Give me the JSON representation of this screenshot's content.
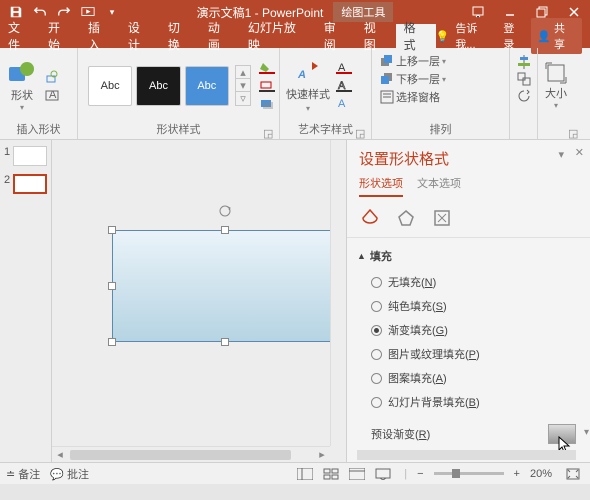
{
  "title": {
    "document": "演示文稿1 - PowerPoint",
    "context_tab": "绘图工具"
  },
  "tabs": {
    "file": "文件",
    "home": "开始",
    "insert": "插入",
    "design": "设计",
    "transitions": "切换",
    "animations": "动画",
    "slideshow": "幻灯片放映",
    "review": "审阅",
    "view": "视图",
    "format": "格式"
  },
  "tab_right": {
    "tell_me": "告诉我...",
    "sign_in": "登录",
    "share": "共享"
  },
  "ribbon": {
    "insert_shapes": {
      "label": "插入形状",
      "shapes": "形状"
    },
    "shape_styles": {
      "label": "形状样式",
      "abc": "Abc"
    },
    "quick_styles": {
      "label": "艺术字样式",
      "btn": "快速样式"
    },
    "arrange": {
      "label": "排列",
      "bring_forward": "上移一层",
      "send_backward": "下移一层",
      "selection_pane": "选择窗格"
    },
    "size": {
      "label": "大小"
    }
  },
  "thumbs": {
    "n1": "1",
    "n2": "2"
  },
  "pane": {
    "title": "设置形状格式",
    "tab_shape": "形状选项",
    "tab_text": "文本选项",
    "fill_section": "填充",
    "no_fill": "无填充",
    "no_fill_k": "N",
    "solid": "纯色填充",
    "solid_k": "S",
    "gradient": "渐变填充",
    "gradient_k": "G",
    "picture": "图片或纹理填充",
    "picture_k": "P",
    "pattern": "图案填充",
    "pattern_k": "A",
    "slide_bg": "幻灯片背景填充",
    "slide_bg_k": "B",
    "preset_gradient": "预设渐变",
    "preset_k": "R"
  },
  "status": {
    "notes": "备注",
    "comments": "批注",
    "zoom": "20%"
  }
}
